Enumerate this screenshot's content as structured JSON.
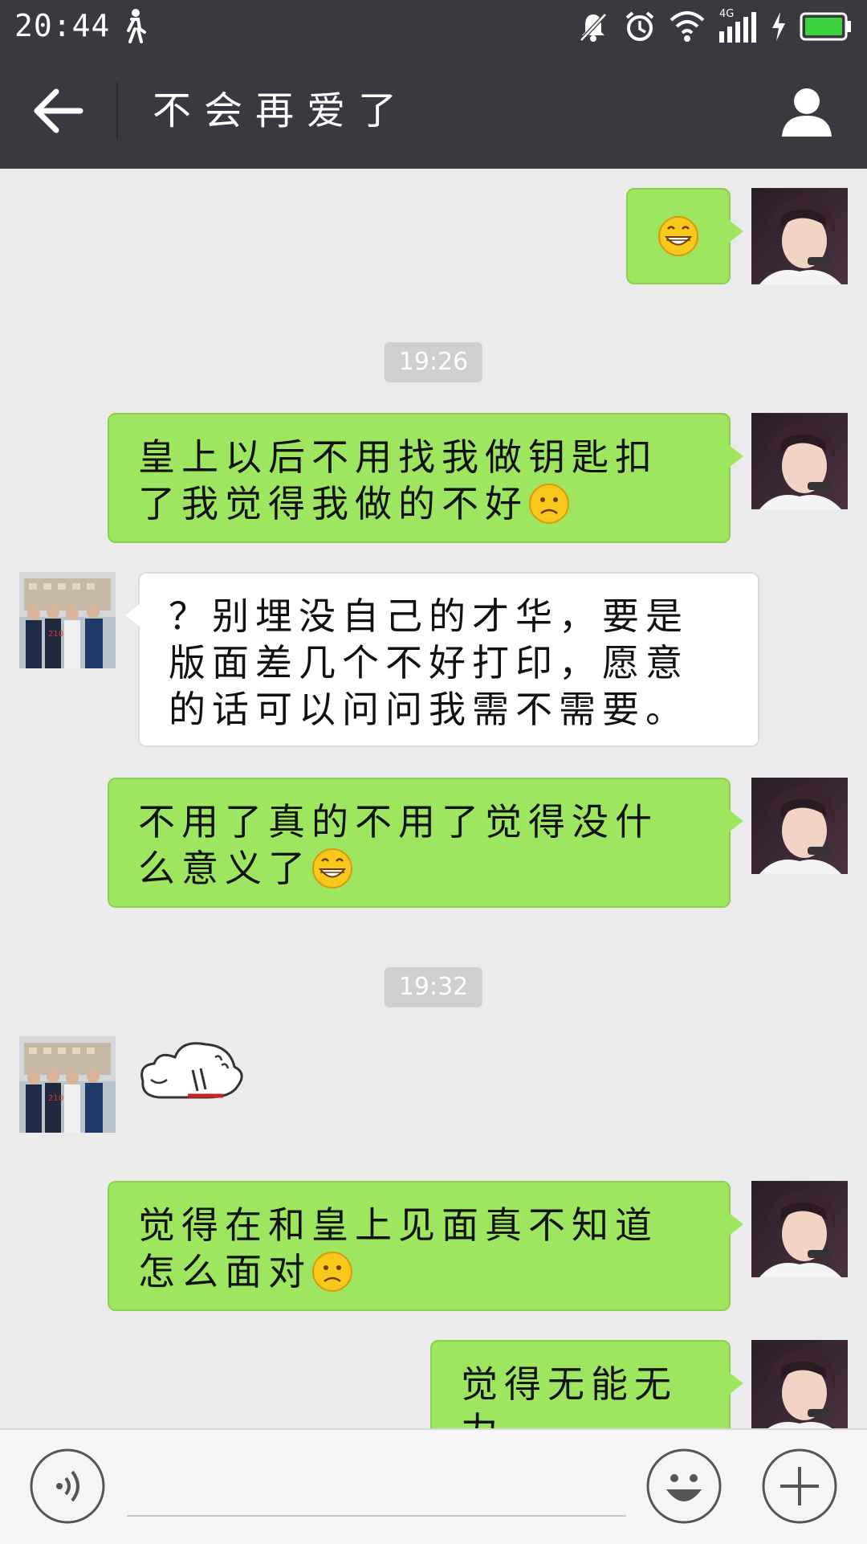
{
  "status_bar": {
    "time": "20:44",
    "network": "4G"
  },
  "header": {
    "title": "不会再爱了"
  },
  "messages": [
    {
      "sender": "me",
      "text": "",
      "emoji": "grin-emoji"
    },
    {
      "type": "timestamp",
      "text": "19:26"
    },
    {
      "sender": "me",
      "text": "皇上以后不用找我做钥匙扣了我觉得我做的不好",
      "emoji": "sad-emoji"
    },
    {
      "sender": "friend",
      "text": "？别埋没自己的才华，要是版面差几个不好打印，愿意的话可以问问我需不需要。"
    },
    {
      "sender": "me",
      "text": "不用了真的不用了觉得没什么意义了",
      "emoji": "grin-emoji"
    },
    {
      "type": "timestamp",
      "text": "19:32"
    },
    {
      "sender": "friend",
      "sticker": "fallen-bird-sticker"
    },
    {
      "sender": "me",
      "text": "觉得在和皇上见面真不知道怎么面对",
      "emoji": "sad-emoji"
    },
    {
      "sender": "me",
      "text": "觉得无能无力"
    }
  ],
  "colors": {
    "bar": "#393a3f",
    "chat_bg": "#ebebeb",
    "my_bubble": "#9ee560",
    "friend_bubble": "#ffffff",
    "timestamp_bg": "#cfcfcf"
  },
  "icons": {
    "back": "arrow-left-icon",
    "profile": "person-icon",
    "voice": "voice-icon",
    "emoji": "smiley-icon",
    "more": "plus-icon"
  }
}
